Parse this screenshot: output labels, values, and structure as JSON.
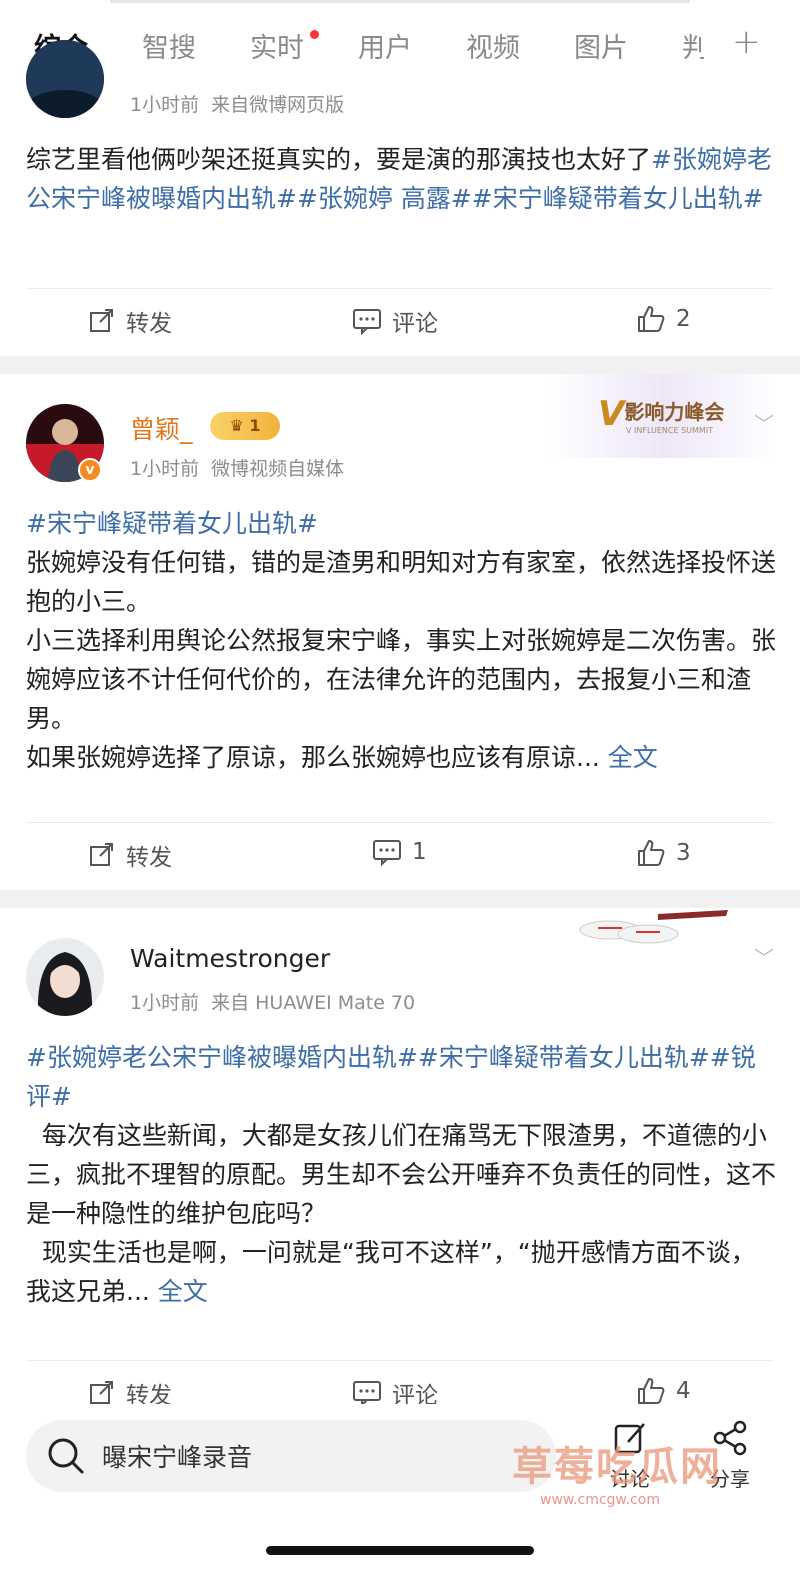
{
  "tabs": [
    "综合",
    "智搜",
    "实时",
    "用户",
    "视频",
    "图片",
    "判"
  ],
  "tab_active": "综合",
  "post1": {
    "time": "1小时前",
    "source": "来自微博网页版",
    "text_plain": "综艺里看他俩吵架还挺真实的，要是演的那演技也太好了",
    "tags": "#张婉婷老公宋宁峰被曝婚内出轨##张婉婷 高露##宋宁峰疑带着女儿出轨#",
    "repost": "转发",
    "comment": "评论",
    "likes": "2"
  },
  "post2": {
    "nick": "曾颖_",
    "level": "1",
    "badge": "影响力峰会",
    "badge_sub": "V INFLUENCE SUMMIT",
    "time": "1小时前",
    "source": "微博视频自媒体",
    "tag": "#宋宁峰疑带着女儿出轨#",
    "para1": "张婉婷没有任何错，错的是渣男和明知对方有家室，依然选择投怀送抱的小三。",
    "para2": "小三选择利用舆论公然报复宋宁峰，事实上对张婉婷是二次伤害。张婉婷应该不计任何代价的，在法律允许的范围内，去报复小三和渣男。",
    "para3": "如果张婉婷选择了原谅，那么张婉婷也应该有原谅...",
    "more": "全文",
    "repost": "转发",
    "comments": "1",
    "likes": "3"
  },
  "post3": {
    "nick": "Waitmestronger",
    "time": "1小时前",
    "source": "来自 HUAWEI Mate 70",
    "tags": "#张婉婷老公宋宁峰被曝婚内出轨##宋宁峰疑带着女儿出轨##锐评#",
    "para1": "  每次有这些新闻，大都是女孩儿们在痛骂无下限渣男，不道德的小三，疯批不理智的原配。男生却不会公开唾弃不负责任的同性，这不是一种隐性的维护包庇吗？",
    "para2": "  现实生活也是啊，一问就是“我可不这样”，“抛开感情方面不谈，我这兄弟...",
    "more": "全文",
    "repost": "转发",
    "comment": "评论",
    "likes": "4"
  },
  "bottom": {
    "search_text": "曝宋宁峰录音",
    "discuss": "讨论",
    "share": "分享",
    "watermark": "草莓吃瓜网",
    "watermark_url": "www.cmcgw.com"
  },
  "colors": {
    "accent": "#f7a21b",
    "link": "#3e6ea8",
    "gold": "#e69a1e"
  }
}
